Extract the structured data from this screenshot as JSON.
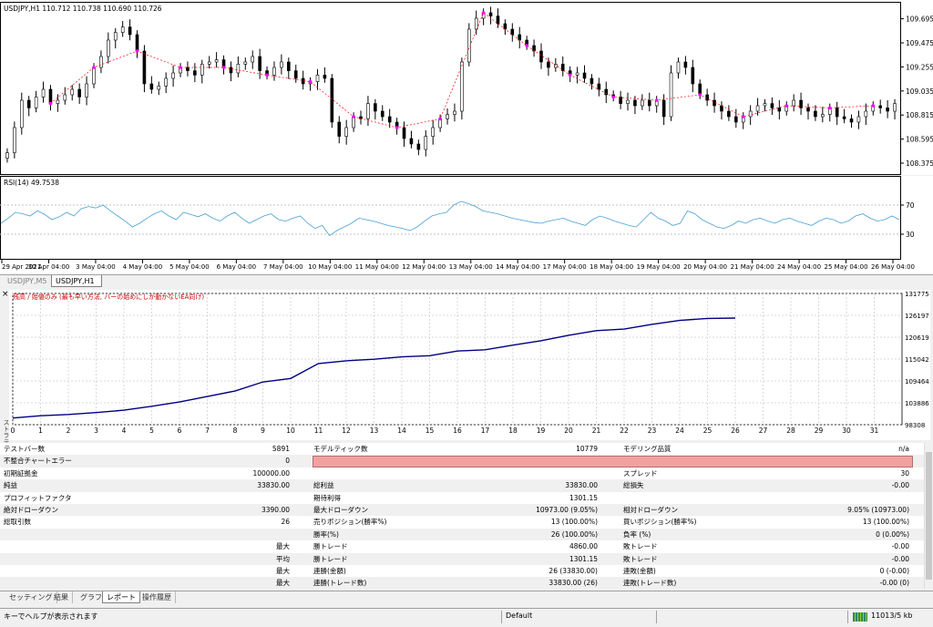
{
  "price_chart": {
    "header": "USDJPY,H1  110.712 110.738 110.690 110.726",
    "price_ticks": [
      "109.695",
      "109.475",
      "109.255",
      "109.035",
      "108.815",
      "108.595",
      "108.375"
    ],
    "price_tick_values": [
      109.695,
      109.475,
      109.255,
      109.035,
      108.815,
      108.595,
      108.375
    ],
    "candle_color": "#000000",
    "signal_line_color": "#ff0000",
    "marker_color": "#ff00ff",
    "closes": [
      108.47,
      108.7,
      108.95,
      108.88,
      108.98,
      109.05,
      108.92,
      108.95,
      109.0,
      109.05,
      108.98,
      109.1,
      109.25,
      109.35,
      109.5,
      109.57,
      109.62,
      109.55,
      109.4,
      109.1,
      109.05,
      109.08,
      109.15,
      109.2,
      109.25,
      109.22,
      109.18,
      109.28,
      109.3,
      109.32,
      109.25,
      109.2,
      109.28,
      109.3,
      109.35,
      109.22,
      109.18,
      109.25,
      109.3,
      109.22,
      109.15,
      109.1,
      109.12,
      109.18,
      109.15,
      108.75,
      108.62,
      108.7,
      108.8,
      108.78,
      108.92,
      108.85,
      108.8,
      108.75,
      108.7,
      108.6,
      108.55,
      108.5,
      108.62,
      108.7,
      108.78,
      108.82,
      108.85,
      109.3,
      109.6,
      109.7,
      109.75,
      109.72,
      109.65,
      109.6,
      109.55,
      109.5,
      109.45,
      109.4,
      109.3,
      109.25,
      109.28,
      109.22,
      109.18,
      109.2,
      109.15,
      109.1,
      109.05,
      109.0,
      108.98,
      108.92,
      108.95,
      108.9,
      108.95,
      108.9,
      108.95,
      108.8,
      109.2,
      109.3,
      109.25,
      109.1,
      109.0,
      108.95,
      108.9,
      108.85,
      108.8,
      108.75,
      108.8,
      108.85,
      108.9,
      108.92,
      108.88,
      108.85,
      108.9,
      108.95,
      108.88,
      108.85,
      108.8,
      108.82,
      108.88,
      108.8,
      108.78,
      108.75,
      108.8,
      108.85,
      108.9,
      108.88,
      108.85,
      108.92
    ]
  },
  "rsi_chart": {
    "header": "RSI(14) 49.7538",
    "levels": [
      "70",
      "30"
    ],
    "level_values": [
      70,
      30
    ],
    "line_color": "#4a9fd4",
    "values": [
      45,
      52,
      60,
      58,
      55,
      62,
      57,
      50,
      54,
      60,
      55,
      65,
      68,
      66,
      70,
      62,
      55,
      48,
      40,
      45,
      52,
      58,
      62,
      55,
      50,
      60,
      57,
      54,
      58,
      52,
      48,
      55,
      60,
      52,
      45,
      50,
      55,
      58,
      50,
      48,
      52,
      55,
      45,
      38,
      42,
      28,
      35,
      40,
      45,
      52,
      50,
      48,
      45,
      42,
      40,
      38,
      35,
      40,
      48,
      55,
      58,
      60,
      70,
      75,
      72,
      68,
      62,
      60,
      58,
      55,
      52,
      50,
      48,
      46,
      45,
      48,
      50,
      52,
      48,
      45,
      42,
      50,
      55,
      52,
      48,
      45,
      42,
      40,
      50,
      60,
      52,
      48,
      42,
      45,
      62,
      58,
      50,
      45,
      40,
      38,
      42,
      48,
      45,
      50,
      52,
      48,
      45,
      50,
      52,
      48,
      45,
      42,
      48,
      52,
      50,
      45,
      48,
      55,
      58,
      52,
      48,
      50,
      55,
      50
    ]
  },
  "time_axis": [
    "29 Apr 2021",
    "30 Apr 04:00",
    "3 May 04:00",
    "4 May 04:00",
    "5 May 04:00",
    "6 May 04:00",
    "7 May 04:00",
    "10 May 04:00",
    "11 May 04:00",
    "12 May 04:00",
    "13 May 04:00",
    "14 May 04:00",
    "17 May 04:00",
    "18 May 04:00",
    "19 May 04:00",
    "20 May 04:00",
    "21 May 04:00",
    "24 May 04:00",
    "25 May 04:00",
    "26 May 04:00"
  ],
  "chart_tabs": [
    {
      "label": "USDJPY,M5",
      "active": false
    },
    {
      "label": "USDJPY,H1",
      "active": true
    }
  ],
  "tester": {
    "close_label": "×",
    "side_label": "ストラテジーテスター",
    "graph_caption": "残高 / 始値のみ (最も早い方法, バーの始めにしか動かないEA向け)",
    "graph_caption_color": "#cc0000",
    "balance_line_color": "#000080"
  },
  "chart_data": {
    "type": "line",
    "title": "残高 / 始値のみ (最も早い方法, バーの始めにしか動かないEA向け)",
    "xlabel": "",
    "ylabel": "",
    "x": [
      0,
      1,
      2,
      3,
      4,
      5,
      6,
      7,
      8,
      9,
      10,
      11,
      12,
      13,
      14,
      15,
      16,
      17,
      18,
      19,
      20,
      21,
      22,
      23,
      24,
      25,
      26
    ],
    "series": [
      {
        "values": [
          100000,
          100600,
          100900,
          101400,
          102000,
          103000,
          104100,
          105500,
          106900,
          109200,
          110100,
          113900,
          114600,
          115000,
          115600,
          115900,
          117100,
          117400,
          118600,
          119700,
          121100,
          122300,
          122700,
          123900,
          124900,
          125400,
          125500
        ]
      }
    ],
    "x_ticks": [
      "0",
      "1",
      "2",
      "3",
      "4",
      "5",
      "6",
      "7",
      "8",
      "9",
      "10",
      "11",
      "12",
      "13",
      "14",
      "15",
      "16",
      "17",
      "18",
      "19",
      "20",
      "21",
      "22",
      "23",
      "24",
      "25",
      "26",
      "27",
      "28",
      "29",
      "30",
      "31"
    ],
    "x_tick_values": [
      0,
      1,
      2,
      3,
      4,
      5,
      6,
      7,
      8,
      9,
      10,
      11,
      12,
      13,
      14,
      15,
      16,
      17,
      18,
      19,
      20,
      21,
      22,
      23,
      24,
      25,
      26,
      27,
      28,
      29,
      30,
      31
    ],
    "y_ticks": [
      "131775",
      "126197",
      "120619",
      "115042",
      "109464",
      "103886",
      "98308"
    ],
    "y_tick_values": [
      131775,
      126197,
      120619,
      115042,
      109464,
      103886,
      98308
    ],
    "xlim": [
      0,
      32
    ],
    "ylim": [
      98308,
      131775
    ],
    "grid": true
  },
  "report": {
    "highlight_color": "#f4a0a0",
    "rows": [
      {
        "c1": "テストバー数",
        "c2": "5891",
        "c3": "モデルティック数",
        "c4": "10779",
        "c5": "モデリング品質",
        "c6": "n/a"
      },
      {
        "c1": "不整合チャートエラー",
        "c2": "0",
        "c3": "",
        "c4": "",
        "c5": "",
        "c6": "",
        "bar": true
      },
      {
        "c1": "初期証拠金",
        "c2": "100000.00",
        "c3": "",
        "c4": "",
        "c5": "スプレッド",
        "c6": "30"
      },
      {
        "c1": "純益",
        "c2": "33830.00",
        "c3": "総利益",
        "c4": "33830.00",
        "c5": "総損失",
        "c6": "-0.00"
      },
      {
        "c1": "プロフィットファクタ",
        "c2": "",
        "c3": "期待利得",
        "c4": "1301.15",
        "c5": "",
        "c6": ""
      },
      {
        "c1": "絶対ドローダウン",
        "c2": "3390.00",
        "c3": "最大ドローダウン",
        "c4": "10973.00 (9.05%)",
        "c5": "相対ドローダウン",
        "c6": "9.05% (10973.00)"
      },
      {
        "c1": "総取引数",
        "c2": "26",
        "c3": "売りポジション(勝率%)",
        "c4": "13 (100.00%)",
        "c5": "買いポジション(勝率%)",
        "c6": "13 (100.00%)"
      },
      {
        "c1": "",
        "c2": "",
        "c3": "勝率(%)",
        "c4": "26 (100.00%)",
        "c5": "負率 (%)",
        "c6": "0 (0.00%)"
      },
      {
        "c1": "",
        "c2": "最大",
        "c3": "勝トレード",
        "c4": "4860.00",
        "c5": "敗トレード",
        "c6": "-0.00"
      },
      {
        "c1": "",
        "c2": "平均",
        "c3": "勝トレード",
        "c4": "1301.15",
        "c5": "敗トレード",
        "c6": "-0.00"
      },
      {
        "c1": "",
        "c2": "最大",
        "c3": "連勝(金額)",
        "c4": "26 (33830.00)",
        "c5": "連敗(金額)",
        "c6": "0 (-0.00)"
      },
      {
        "c1": "",
        "c2": "最大",
        "c3": "連勝(トレード数)",
        "c4": "33830.00 (26)",
        "c5": "連敗(トレード数)",
        "c6": "-0.00 (0)"
      }
    ]
  },
  "bottom_tabs": [
    {
      "label": "セッティング",
      "active": false
    },
    {
      "label": "結果",
      "active": false
    },
    {
      "label": "グラフ",
      "active": false
    },
    {
      "label": "レポート",
      "active": true
    },
    {
      "label": "操作履歴",
      "active": false
    }
  ],
  "status_bar": {
    "help": "キーでヘルプが表示されます",
    "profile": "Default",
    "traffic": "11013/5 kb"
  }
}
